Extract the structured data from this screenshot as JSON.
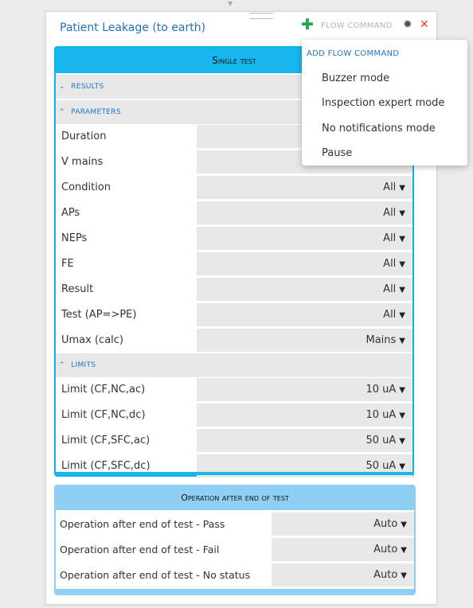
{
  "card": {
    "title": "Patient Leakage (to earth)",
    "flow_command_label": "FLOW COMMAND"
  },
  "flow_menu": {
    "header": "ADD FLOW COMMAND",
    "items": [
      "Buzzer mode",
      "Inspection expert mode",
      "No notifications mode",
      "Pause"
    ]
  },
  "single_test": {
    "title": "Single test",
    "results_label": "RESULTS",
    "parameters_label": "PARAMETERS",
    "limits_label": "LIMITS",
    "parameters": [
      {
        "label": "Duration",
        "value": ""
      },
      {
        "label": "V mains",
        "value": ""
      },
      {
        "label": "Condition",
        "value": "All"
      },
      {
        "label": "APs",
        "value": "All"
      },
      {
        "label": "NEPs",
        "value": "All"
      },
      {
        "label": "FE",
        "value": "All"
      },
      {
        "label": "Result",
        "value": "All"
      },
      {
        "label": "Test (AP=>PE)",
        "value": "All"
      },
      {
        "label": "Umax (calc)",
        "value": "Mains"
      }
    ],
    "limits": [
      {
        "label": "Limit (CF,NC,ac)",
        "value": "10 uA"
      },
      {
        "label": "Limit (CF,NC,dc)",
        "value": "10 uA"
      },
      {
        "label": "Limit (CF,SFC,ac)",
        "value": "50 uA"
      },
      {
        "label": "Limit (CF,SFC,dc)",
        "value": "50 uA"
      }
    ]
  },
  "operation_after": {
    "title": "Operation after end of test",
    "rows": [
      {
        "label": "Operation after end of test - Pass",
        "value": "Auto"
      },
      {
        "label": "Operation after end of test - Fail",
        "value": "Auto"
      },
      {
        "label": "Operation after end of test - No status",
        "value": "Auto"
      }
    ]
  },
  "icons": {
    "plus": "plus-icon",
    "gear": "gear-icon",
    "close": "close-icon",
    "chevron_down": "chevron-down-icon",
    "chevron_up": "chevron-up-icon",
    "caret_down": "caret-down-icon"
  },
  "colors": {
    "accent": "#17b7ee",
    "secondary_header": "#8ecff3",
    "title_blue": "#1f72c4",
    "plus_green": "#1fa84b",
    "close_red": "#e23b3b"
  }
}
